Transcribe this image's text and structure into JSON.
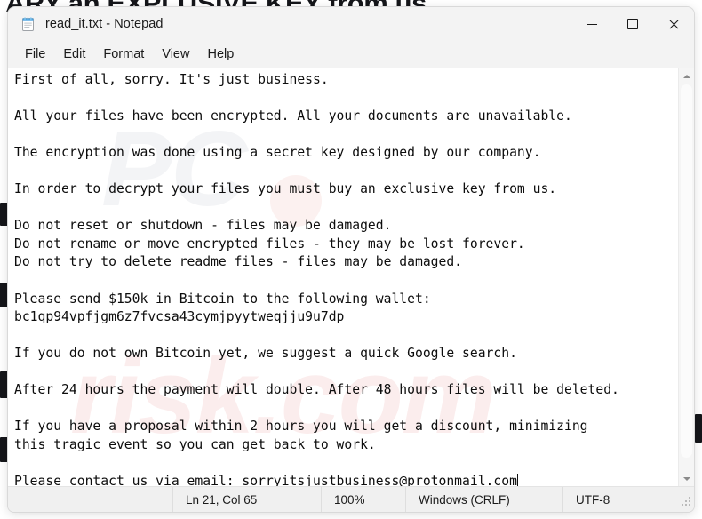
{
  "backdrop": {
    "headline_text": "ARY an EXPLUSIVE KEY from us"
  },
  "window": {
    "title": "read_it.txt - Notepad",
    "app_icon": "notepad-icon",
    "controls": {
      "minimize": "minimize-icon",
      "maximize": "maximize-icon",
      "close": "close-icon"
    }
  },
  "menu": {
    "items": [
      {
        "label": "File"
      },
      {
        "label": "Edit"
      },
      {
        "label": "Format"
      },
      {
        "label": "View"
      },
      {
        "label": "Help"
      }
    ]
  },
  "document": {
    "body": "First of all, sorry. It's just business.\n\nAll your files have been encrypted. All your documents are unavailable.\n\nThe encryption was done using a secret key designed by our company.\n\nIn order to decrypt your files you must buy an exclusive key from us.\n\nDo not reset or shutdown - files may be damaged.\nDo not rename or move encrypted files - they may be lost forever.\nDo not try to delete readme files - files may be damaged.\n\nPlease send $150k in Bitcoin to the following wallet:\nbc1qp94vpfjgm6z7fvcsa43cymjpyytweqjju9u7dp\n\nIf you do not own Bitcoin yet, we suggest a quick Google search.\n\nAfter 24 hours the payment will double. After 48 hours files will be deleted.\n\nIf you have a proposal within 2 hours you will get a discount, minimizing\nthis tragic event so you can get back to work.\n\nPlease contact us via email: sorryitsjustbusiness@protonmail.com",
    "lines": [
      "First of all, sorry. It's just business.",
      "",
      "All your files have been encrypted. All your documents are unavailable.",
      "",
      "The encryption was done using a secret key designed by our company.",
      "",
      "In order to decrypt your files you must buy an exclusive key from us.",
      "",
      "Do not reset or shutdown - files may be damaged.",
      "Do not rename or move encrypted files - they may be lost forever.",
      "Do not try to delete readme files - files may be damaged.",
      "",
      "Please send $150k in Bitcoin to the following wallet:",
      "bc1qp94vpfjgm6z7fvcsa43cymjpyytweqjju9u7dp",
      "",
      "If you do not own Bitcoin yet, we suggest a quick Google search.",
      "",
      "After 24 hours the payment will double. After 48 hours files will be deleted.",
      "",
      "If you have a proposal within 2 hours you will get a discount, minimizing",
      "this tragic event so you can get back to work.",
      "",
      "Please contact us via email: sorryitsjustbusiness@protonmail.com"
    ],
    "ransom_amount": "$150k",
    "bitcoin_wallet": "bc1qp94vpfjgm6z7fvcsa43cymjpyytweqjju9u7dp",
    "contact_email": "sorryitsjustbusiness@protonmail.com"
  },
  "watermark": {
    "text_grey": "PC",
    "text_red": "risk.com"
  },
  "scrollbar": {
    "up_arrow": "scroll-up-icon",
    "down_arrow": "scroll-down-icon"
  },
  "status_bar": {
    "position": "Ln 21, Col 65",
    "zoom": "100%",
    "line_ending": "Windows (CRLF)",
    "encoding": "UTF-8"
  },
  "colors": {
    "window_chrome": "#f3f3f3",
    "editor_bg": "#ffffff",
    "text": "#0d0d0d",
    "status_bg": "#f0f0f0",
    "close_hover": "#c42b1c"
  }
}
